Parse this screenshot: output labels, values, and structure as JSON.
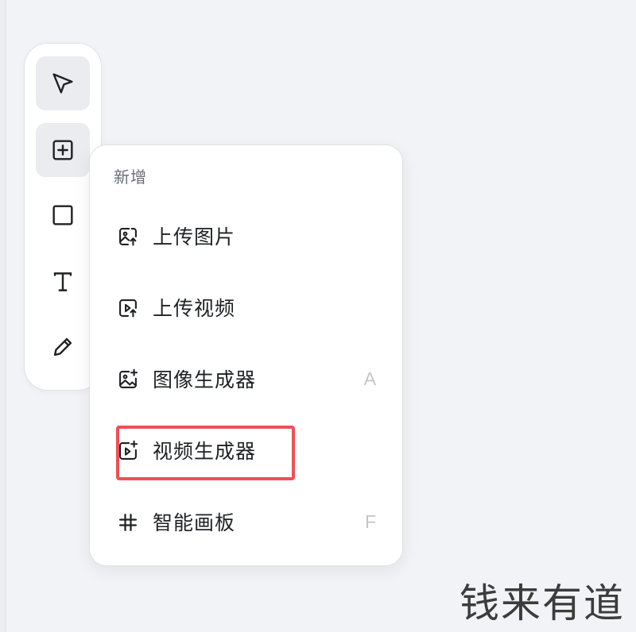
{
  "toolbar": {
    "tools": [
      {
        "name": "select-tool",
        "icon": "pointer-arrow-icon",
        "active": true
      },
      {
        "name": "add-tool",
        "icon": "plus-square-icon",
        "active": true
      },
      {
        "name": "rectangle-tool",
        "icon": "square-icon",
        "active": false
      },
      {
        "name": "text-tool",
        "icon": "text-t-icon",
        "active": false
      },
      {
        "name": "pen-tool",
        "icon": "pen-icon",
        "active": false
      }
    ]
  },
  "menu": {
    "heading": "新增",
    "items": [
      {
        "label": "上传图片",
        "icon": "image-upload-icon",
        "shortcut": ""
      },
      {
        "label": "上传视频",
        "icon": "video-upload-icon",
        "shortcut": ""
      },
      {
        "label": "图像生成器",
        "icon": "image-sparkle-icon",
        "shortcut": "A"
      },
      {
        "label": "视频生成器",
        "icon": "video-sparkle-icon",
        "shortcut": "",
        "highlighted": true
      },
      {
        "label": "智能画板",
        "icon": "hash-icon",
        "shortcut": "F"
      }
    ]
  },
  "colors": {
    "highlight_border": "#ee4f55",
    "background": "#f2f3f6"
  },
  "watermark": "钱来有道"
}
